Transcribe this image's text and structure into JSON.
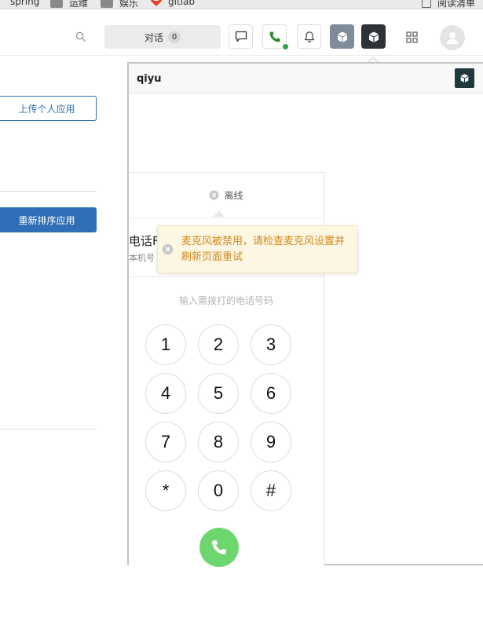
{
  "bookmarks": [
    {
      "label": "spring",
      "icon": "folder-icon"
    },
    {
      "label": "运维",
      "icon": "folder-icon"
    },
    {
      "label": "娱乐",
      "icon": "folder-icon"
    },
    {
      "label": "gitlab",
      "icon": "gitlab-icon"
    },
    {
      "label": "阅读清单",
      "icon": "reading-list-icon"
    }
  ],
  "header": {
    "chat_label": "对话",
    "chat_count": "0",
    "phone_status_color": "#2ca44a"
  },
  "left": {
    "upload_label": "上传个人应用",
    "reorder_label": "重新排序应用"
  },
  "panel": {
    "title": "qiyu",
    "status_label": "离线",
    "line_title": "电话F",
    "line_sub": "本机号",
    "dial_placeholder": "输入需拨打的电话号码",
    "keys": [
      "1",
      "2",
      "3",
      "4",
      "5",
      "6",
      "7",
      "8",
      "9",
      "*",
      "0",
      "#"
    ],
    "call_color": "#6ed66e"
  },
  "toast": {
    "message": "麦克风被禁用，请检查麦克风设置并刷新页面重试",
    "color": "#d08a1a"
  },
  "colors": {
    "primary": "#2f6fb5",
    "panel_logo": "#1f3a3d"
  }
}
